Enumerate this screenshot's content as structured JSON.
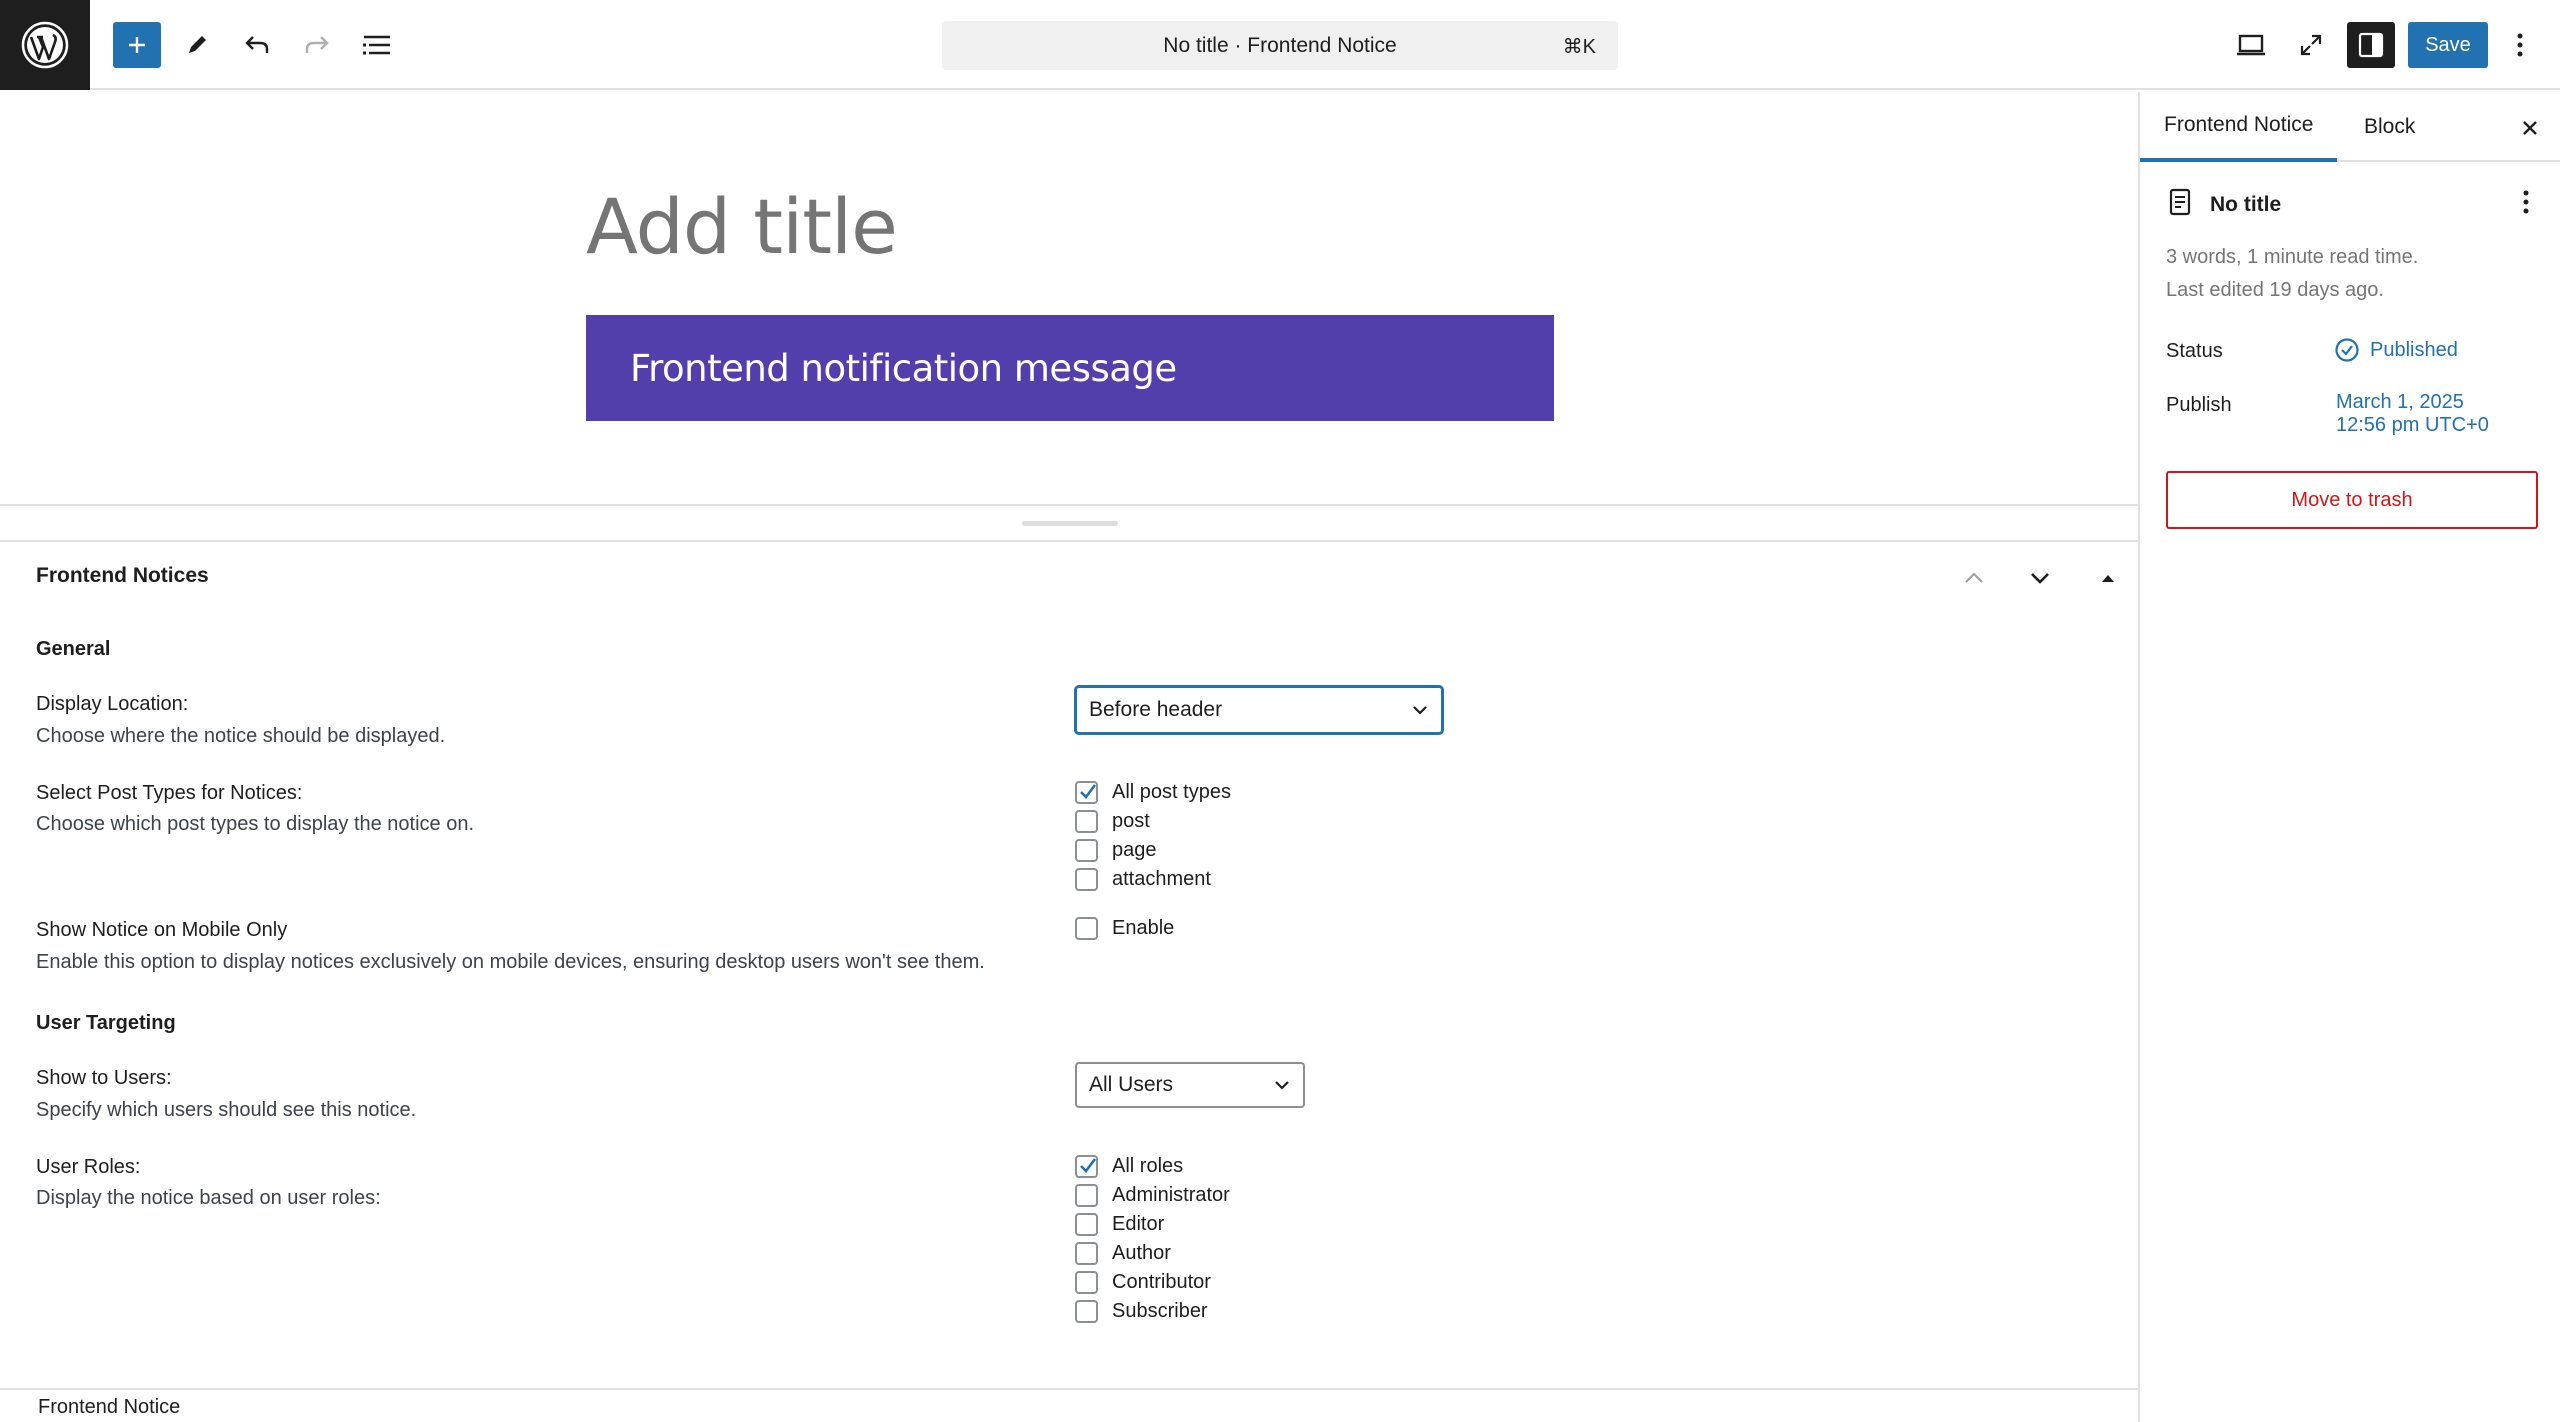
{
  "toolbar": {
    "logo_icon": "wordpress-icon",
    "inserter_icon": "plus-icon",
    "tools_icon": "pencil-icon",
    "undo_icon": "undo-icon",
    "redo_icon": "redo-icon",
    "list_view_icon": "list-view-icon",
    "document_bar_title": "No title · Frontend Notice",
    "document_bar_shortcut": "⌘K",
    "view_icon": "desktop-icon",
    "fullscreen_icon": "fullscreen-icon",
    "settings_icon": "sidebar-icon",
    "save_label": "Save",
    "options_icon": "more-vertical-icon"
  },
  "editor": {
    "title_placeholder": "Add title",
    "notice_text": "Frontend notification message",
    "notice_bg": "#533fab"
  },
  "metabox": {
    "title": "Frontend Notices",
    "general_heading": "General",
    "display_location": {
      "label": "Display Location:",
      "description": "Choose where the notice should be displayed.",
      "selected": "Before header"
    },
    "post_types": {
      "label": "Select Post Types for Notices:",
      "description": "Choose which post types to display the notice on.",
      "options": [
        {
          "label": "All post types",
          "checked": true
        },
        {
          "label": "post",
          "checked": false
        },
        {
          "label": "page",
          "checked": false
        },
        {
          "label": "attachment",
          "checked": false
        }
      ]
    },
    "mobile_only": {
      "label": "Show Notice on Mobile Only",
      "description": "Enable this option to display notices exclusively on mobile devices, ensuring desktop users won't see them.",
      "checkbox_label": "Enable",
      "checked": false
    },
    "user_targeting_heading": "User Targeting",
    "show_to_users": {
      "label": "Show to Users:",
      "description": "Specify which users should see this notice.",
      "selected": "All Users"
    },
    "user_roles": {
      "label": "User Roles:",
      "description": "Display the notice based on user roles:",
      "options": [
        {
          "label": "All roles",
          "checked": true
        },
        {
          "label": "Administrator",
          "checked": false
        },
        {
          "label": "Editor",
          "checked": false
        },
        {
          "label": "Author",
          "checked": false
        },
        {
          "label": "Contributor",
          "checked": false
        },
        {
          "label": "Subscriber",
          "checked": false
        }
      ]
    }
  },
  "footer": {
    "breadcrumb": "Frontend Notice"
  },
  "sidebar": {
    "tab_document": "Frontend Notice",
    "tab_block": "Block",
    "doc_title": "No title",
    "meta_words": "3 words, 1 minute read time.",
    "meta_edited": "Last edited 19 days ago.",
    "status_label": "Status",
    "status_value": "Published",
    "publish_label": "Publish",
    "publish_date": "March 1, 2025",
    "publish_time": "12:56 pm UTC+0",
    "trash_label": "Move to trash",
    "accent_color": "#2271b1",
    "danger_color": "#cc1818"
  }
}
